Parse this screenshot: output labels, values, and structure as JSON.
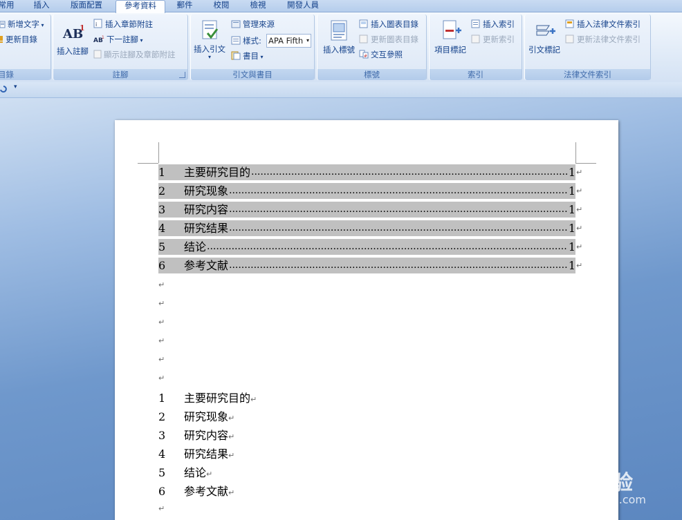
{
  "tabs": [
    "常用",
    "插入",
    "版面配置",
    "參考資料",
    "郵件",
    "校閱",
    "檢視",
    "開發人員"
  ],
  "active_tab": "參考資料",
  "groups": {
    "toc": {
      "label": "目錄",
      "add_text": "新增文字",
      "update_toc": "更新目錄"
    },
    "footnotes": {
      "label": "註腳",
      "insert_footnote": "插入註腳",
      "insert_endnote": "插入章節附註",
      "next_footnote": "下一註腳",
      "show_notes": "顯示註腳及章節附註"
    },
    "citations": {
      "label": "引文與書目",
      "insert_citation": "插入引文",
      "manage_sources": "管理來源",
      "style_label": "樣式:",
      "style_value": "APA Fifth",
      "bibliography": "書目"
    },
    "captions": {
      "label": "標號",
      "insert_caption": "插入標號",
      "insert_table_of_figures": "插入圖表目錄",
      "update_table": "更新圖表目錄",
      "cross_reference": "交互參照"
    },
    "index": {
      "label": "索引",
      "mark_entry": "項目標記",
      "insert_index": "插入索引",
      "update_index": "更新索引"
    },
    "authorities": {
      "label": "法律文件索引",
      "mark_citation": "引文標記",
      "insert_toa": "插入法律文件索引",
      "update_toa": "更新法律文件索引"
    }
  },
  "document": {
    "toc_entries": [
      {
        "num": "1",
        "title": "主要研究目的",
        "page": "1"
      },
      {
        "num": "2",
        "title": "研究现象",
        "page": "1"
      },
      {
        "num": "3",
        "title": "研究内容",
        "page": "1"
      },
      {
        "num": "4",
        "title": "研究结果",
        "page": "1"
      },
      {
        "num": "5",
        "title": "结论",
        "page": "1"
      },
      {
        "num": "6",
        "title": "参考文献",
        "page": "1"
      }
    ],
    "headings": [
      {
        "num": "1",
        "title": "主要研究目的"
      },
      {
        "num": "2",
        "title": "研究现象"
      },
      {
        "num": "3",
        "title": "研究内容"
      },
      {
        "num": "4",
        "title": "研究结果"
      },
      {
        "num": "5",
        "title": "结论"
      },
      {
        "num": "6",
        "title": "参考文献"
      }
    ],
    "para_mark": "↵"
  },
  "watermark": {
    "brand": "Bai  经验",
    "url": "jingyan.baidu.com"
  }
}
